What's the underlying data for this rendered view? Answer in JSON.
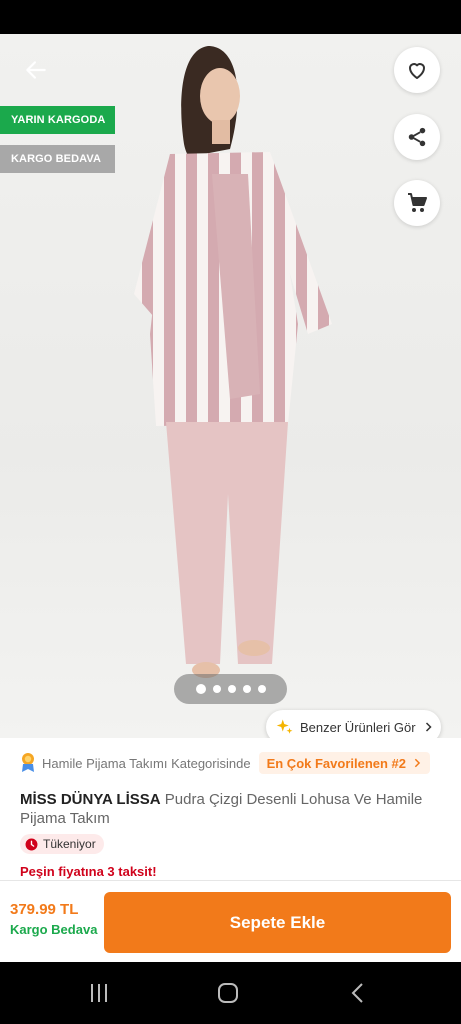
{
  "badges": {
    "next_day": "YARIN KARGODA",
    "free_shipping": "KARGO BEDAVA"
  },
  "gallery": {
    "image_count": 5,
    "active_index": 0
  },
  "similar_button": {
    "label": "Benzer Ürünleri Gör"
  },
  "category": {
    "text": "Hamile Pijama Takımı Kategorisinde",
    "favorite_label": "En Çok Favorilenen #2"
  },
  "product": {
    "brand": "MİSS DÜNYA LİSSA",
    "name": "Pudra Çizgi Desenli Lohusa Ve Hamile Pijama Takım",
    "stock_label": "Tükeniyor",
    "installment": "Peşin fiyatına 3 taksit!"
  },
  "purchase": {
    "price": "379.99 TL",
    "shipping": "Kargo Bedava",
    "add_to_cart": "Sepete Ekle"
  },
  "colors": {
    "accent": "#f27a1a",
    "green": "#1ba94c",
    "gray_badge": "#a8a8a8",
    "danger": "#d0021b"
  },
  "icons": [
    "arrow-left",
    "heart",
    "share",
    "cart",
    "sparkle",
    "chevron-right",
    "award",
    "clock",
    "recent-apps",
    "home",
    "back"
  ]
}
